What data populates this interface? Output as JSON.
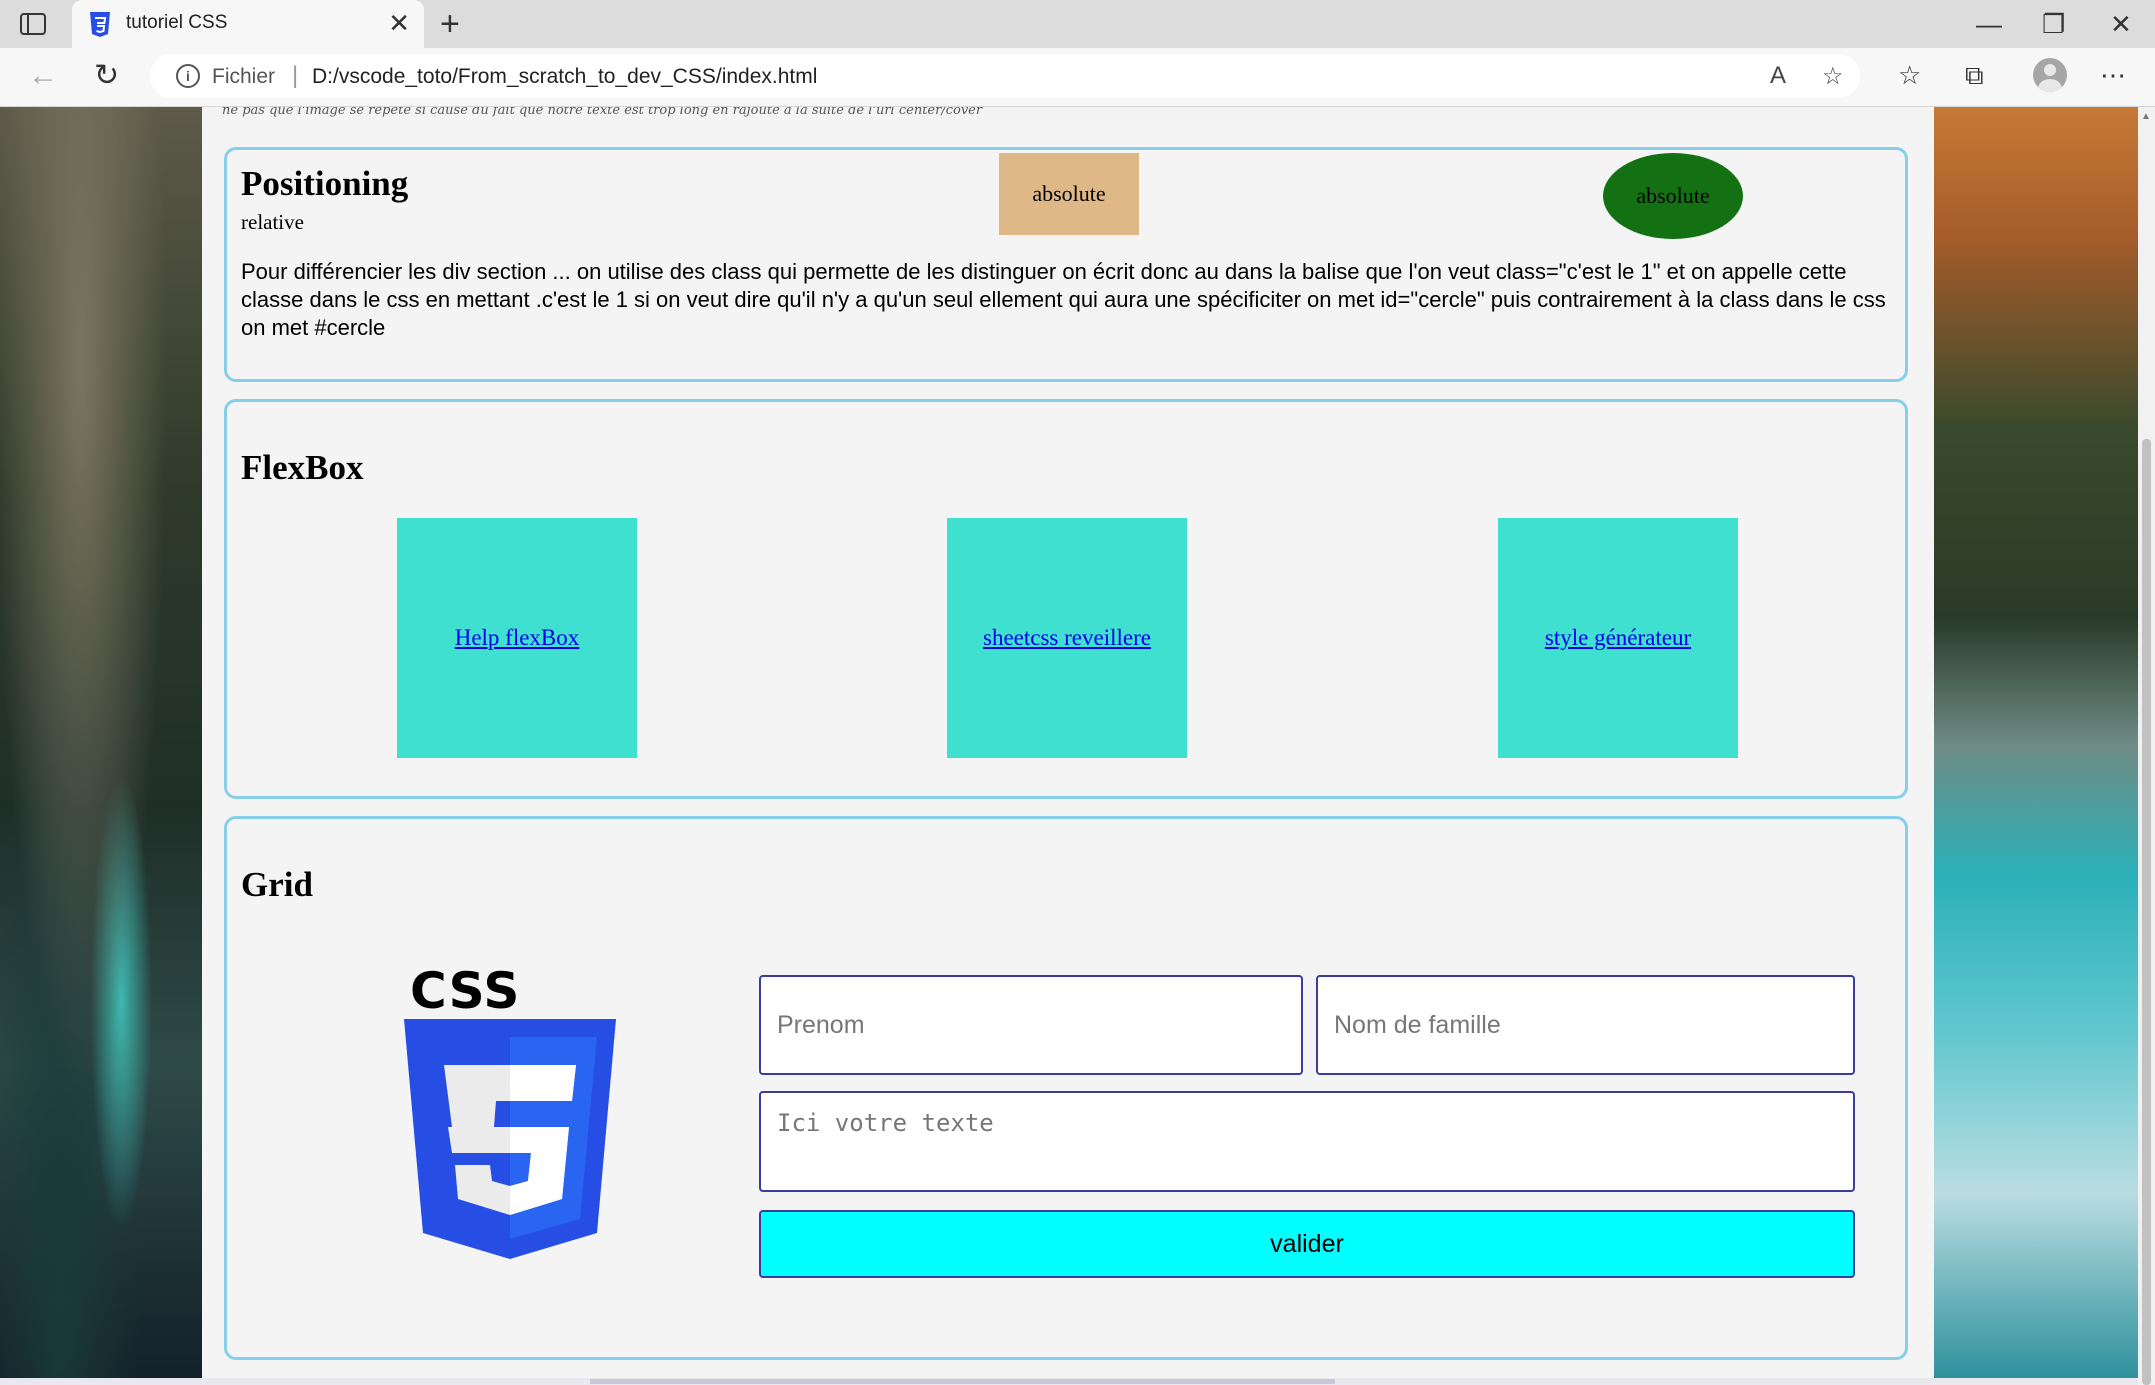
{
  "browser": {
    "tab_title": "tutoriel CSS",
    "tab_close": "✕",
    "new_tab": "+",
    "file_label": "Fichier",
    "url": "D:/vscode_toto/From_scratch_to_dev_CSS/index.html",
    "window_minimize": "—",
    "window_restore": "❐",
    "window_close": "✕",
    "back": "←",
    "reload": "↻",
    "read_aloud": "A",
    "favorite_add": "☆",
    "favorites": "☆",
    "collections": "⧉",
    "menu": "⋯"
  },
  "page": {
    "clipped_line": "ne pas que l'image se répète si cause du fait que notre texte est trop long en rajoute a la suite de l'url center/cover",
    "positioning": {
      "title": "Positioning",
      "relative_label": "relative",
      "absolute_box_label": "absolute",
      "absolute_circle_label": "absolute",
      "paragraph": "Pour différencier les div section ... on utilise des class qui permette de les distinguer on écrit donc au dans la balise que l'on veut class=\"c'est le 1\" et on appelle cette classe dans le css en mettant .c'est le 1 si on veut dire qu'il n'y a qu'un seul ellement qui aura une spécificiter on met id=\"cercle\" puis contrairement à la class dans le css on met #cercle"
    },
    "flexbox": {
      "title": "FlexBox",
      "links": [
        "Help flexBox",
        "sheetcss reveillere",
        "style générateur"
      ]
    },
    "grid": {
      "title": "Grid",
      "logo_text": "CSS",
      "firstname_placeholder": "Prenom",
      "lastname_placeholder": "Nom de famille",
      "message_placeholder": "Ici votre texte",
      "submit_label": "valider"
    }
  },
  "colors": {
    "section_border": "#87ceeb",
    "absolute_box": "#deb887",
    "absolute_circle": "#137113",
    "flex_box": "#40e0d0",
    "submit_bg": "#00ffff",
    "css3_blue": "#264de4"
  }
}
